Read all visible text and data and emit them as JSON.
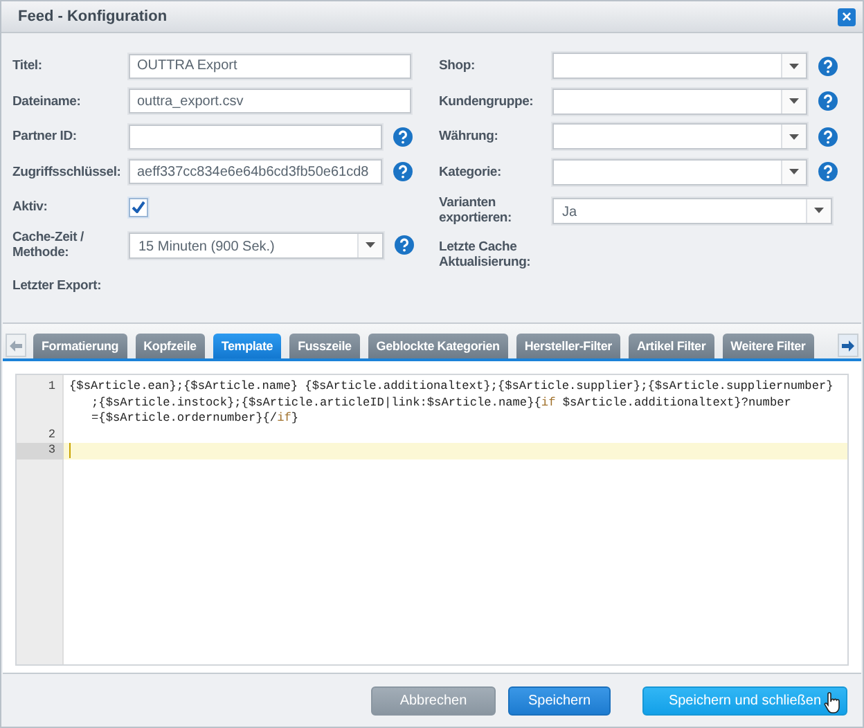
{
  "window": {
    "title": "Feed - Konfiguration",
    "close": "×"
  },
  "form_left": [
    {
      "label": "Titel:",
      "kind": "text",
      "value": "OUTTRA Export",
      "help": false
    },
    {
      "label": "Dateiname:",
      "kind": "text",
      "value": "outtra_export.csv",
      "help": false
    },
    {
      "label": "Partner ID:",
      "kind": "text",
      "help": true
    },
    {
      "label": "Zugriffsschlüssel:",
      "kind": "text",
      "value": "aeff337cc834e6e64b6cd3fb50e61cd8",
      "help": true
    },
    {
      "label": "Aktiv:",
      "kind": "checkbox",
      "checked": true,
      "help": false
    },
    {
      "label": "Cache-Zeit / Methode:",
      "kind": "select",
      "value": "15 Minuten (900 Sek.)",
      "help": true
    },
    {
      "label": "Letzter Export:",
      "kind": "static",
      "help": false
    }
  ],
  "form_right": [
    {
      "label": "Shop:",
      "kind": "select",
      "help": true
    },
    {
      "label": "Kundengruppe:",
      "kind": "select",
      "help": true
    },
    {
      "label": "Währung:",
      "kind": "select",
      "help": true
    },
    {
      "label": "Kategorie:",
      "kind": "select",
      "help": true
    },
    {
      "label": "Varianten exportieren:",
      "kind": "select",
      "value": "Ja",
      "help": false
    },
    {
      "label": "Letzte Cache Aktualisierung:",
      "kind": "static",
      "help": false
    }
  ],
  "tabs": [
    {
      "label": "Formatierung",
      "selected": false
    },
    {
      "label": "Kopfzeile",
      "selected": false
    },
    {
      "label": "Template",
      "selected": true
    },
    {
      "label": "Fusszeile",
      "selected": false
    },
    {
      "label": "Geblockte Kategorien",
      "selected": false
    },
    {
      "label": "Hersteller-Filter",
      "selected": false
    },
    {
      "label": "Artikel Filter",
      "selected": false
    },
    {
      "label": "Weitere Filter",
      "selected": false
    }
  ],
  "editor": {
    "rows": [
      {
        "number": "1",
        "active": false,
        "tokens": [
          {
            "kind": "text",
            "text": "{$sArticle.ean};{$sArticle.name} {$sArticle.additionaltext};{$sArticle.supplier};{$sArticle.suppliernumber}"
          }
        ]
      },
      {
        "active": false,
        "tokens": [
          {
            "kind": "text",
            "text": ";{$sArticle.instock};{$sArticle.articleID|link:$sArticle.name}{"
          },
          {
            "kind": "keyword",
            "text": "if"
          },
          {
            "kind": "text",
            "text": " $sArticle.additionaltext}?number"
          }
        ]
      },
      {
        "active": false,
        "tokens": [
          {
            "kind": "text",
            "text": "={$sArticle.ordernumber}{/"
          },
          {
            "kind": "keyword",
            "text": "if"
          },
          {
            "kind": "text",
            "text": "}"
          }
        ]
      },
      {
        "number": "2",
        "active": false,
        "tokens": []
      },
      {
        "number": "3",
        "active": true,
        "tokens": []
      }
    ]
  },
  "buttons": [
    {
      "label": "Abbrechen",
      "kind": "secondary"
    },
    {
      "label": "Speichern",
      "kind": "primary"
    },
    {
      "label": "Speichern und schließen",
      "kind": "accent"
    }
  ]
}
